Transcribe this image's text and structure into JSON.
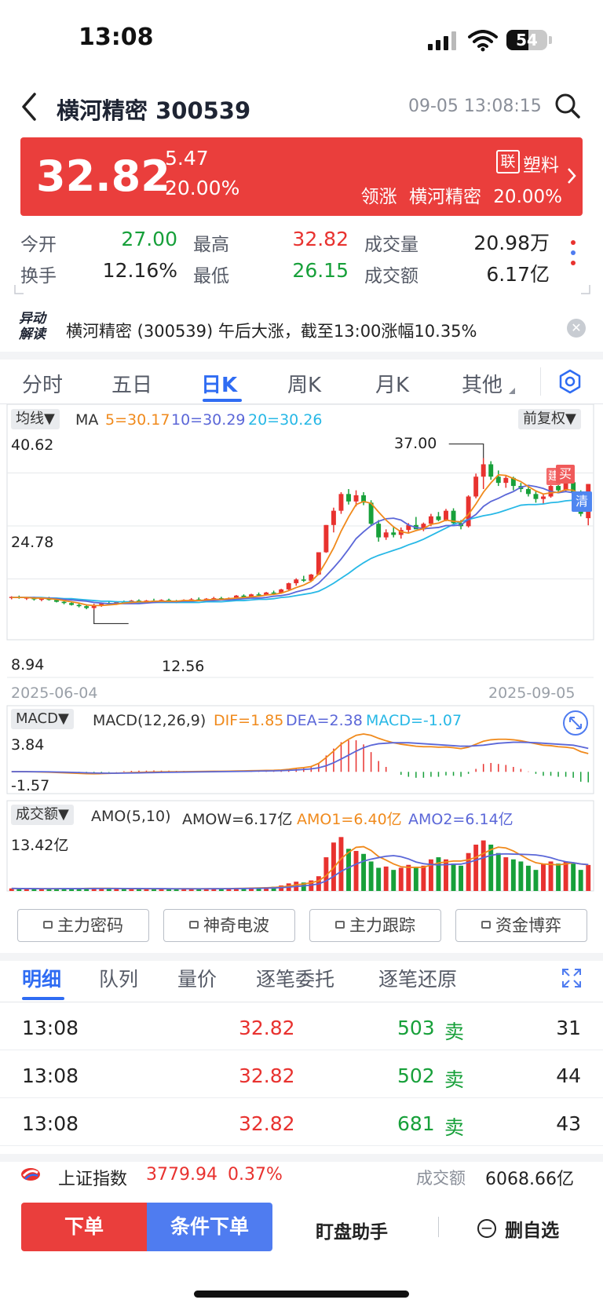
{
  "status_bar": {
    "time": "13:08",
    "battery": "54",
    "battery_level": 0.54
  },
  "nav": {
    "title": "横河精密 300539",
    "datetime": "09-05 13:08:15"
  },
  "quote": {
    "price": "32.82",
    "change": "5.47",
    "change_pct": "20.00%",
    "sector_badge": "联",
    "sector_name": "塑料",
    "lead_label": "领涨",
    "lead_stock": "横河精密",
    "lead_pct": "20.00%"
  },
  "stats": [
    {
      "label": "今开",
      "value": "27.00",
      "color": "#17a03a"
    },
    {
      "label": "最高",
      "value": "32.82",
      "color": "#e8322f"
    },
    {
      "label": "成交量",
      "value": "20.98万",
      "color": "#222222"
    },
    {
      "label": "换手",
      "value": "12.16%",
      "color": "#222222"
    },
    {
      "label": "最低",
      "value": "26.15",
      "color": "#17a03a"
    },
    {
      "label": "成交额",
      "value": "6.17亿",
      "color": "#222222"
    }
  ],
  "news": {
    "tag_line1": "异动",
    "tag_line2": "解读",
    "text": "横河精密 (300539) 午后大涨，截至13:00涨幅10.35%"
  },
  "chart_tabs": [
    "分时",
    "五日",
    "日K",
    "周K",
    "月K",
    "其他"
  ],
  "active_chart_tab": "日K",
  "kline": {
    "ma_selector": "均线▼",
    "ma_prefix": "MA",
    "ma5": "5=30.17",
    "ma10": "10=30.29",
    "ma20": "20=30.26",
    "adjust": "前复权▼",
    "y_max": "40.62",
    "y_mid": "24.78",
    "y_min": "8.94",
    "high_label": "37.00",
    "low_label": "12.56",
    "date_start": "2025-06-04",
    "date_end": "2025-09-05",
    "buy_mark": "买",
    "build_mark": "建",
    "clear_mark": "清",
    "macd_selector": "MACD▼",
    "macd_params": "MACD(12,26,9)",
    "dif": "DIF=1.85",
    "dea": "DEA=2.38",
    "macd": "MACD=-1.07",
    "macd_max": "3.84",
    "macd_min": "-1.57",
    "amo_selector": "成交额▼",
    "amo_params": "AMO(5,10)",
    "amow": "AMOW=6.17亿",
    "amo1": "AMO1=6.40亿",
    "amo2": "AMO2=6.14亿",
    "amo_max": "13.42亿"
  },
  "chart_data": {
    "type": "candlestick",
    "y_range": [
      8.94,
      40.62
    ],
    "x_range": [
      "2025-06-04",
      "2025-09-05"
    ],
    "candles": [
      [
        14.5,
        14.7,
        14.2,
        14.6
      ],
      [
        14.6,
        14.8,
        14.3,
        14.4
      ],
      [
        14.4,
        14.6,
        14.1,
        14.5
      ],
      [
        14.5,
        14.6,
        14.0,
        14.2
      ],
      [
        14.2,
        14.5,
        13.9,
        14.3
      ],
      [
        14.3,
        14.6,
        14.0,
        14.1
      ],
      [
        14.1,
        14.3,
        13.7,
        13.8
      ],
      [
        13.8,
        14.0,
        13.4,
        13.6
      ],
      [
        13.6,
        13.9,
        13.2,
        13.3
      ],
      [
        13.3,
        13.6,
        12.9,
        13.1
      ],
      [
        13.1,
        13.4,
        12.6,
        12.8
      ],
      [
        12.8,
        13.5,
        12.56,
        13.3
      ],
      [
        13.3,
        13.7,
        13.0,
        13.6
      ],
      [
        13.6,
        13.9,
        13.3,
        13.5
      ],
      [
        13.5,
        13.9,
        13.3,
        13.8
      ],
      [
        13.8,
        14.0,
        13.5,
        13.7
      ],
      [
        13.7,
        14.1,
        13.5,
        14.0
      ],
      [
        14.0,
        14.2,
        13.7,
        13.8
      ],
      [
        13.8,
        14.1,
        13.6,
        14.0
      ],
      [
        14.0,
        14.3,
        13.8,
        13.9
      ],
      [
        13.9,
        14.2,
        13.7,
        14.1
      ],
      [
        14.1,
        14.3,
        13.8,
        13.9
      ],
      [
        13.9,
        14.1,
        13.6,
        13.8
      ],
      [
        13.8,
        14.2,
        13.7,
        14.1
      ],
      [
        14.1,
        14.4,
        13.9,
        14.2
      ],
      [
        14.2,
        14.5,
        14.0,
        14.1
      ],
      [
        14.1,
        14.4,
        13.9,
        14.3
      ],
      [
        14.3,
        14.6,
        14.1,
        14.4
      ],
      [
        14.4,
        14.6,
        14.1,
        14.2
      ],
      [
        14.2,
        14.5,
        14.0,
        14.4
      ],
      [
        14.4,
        14.9,
        14.3,
        14.8
      ],
      [
        14.8,
        15.0,
        14.4,
        14.5
      ],
      [
        14.5,
        15.1,
        14.4,
        15.0
      ],
      [
        15.0,
        15.3,
        14.7,
        14.9
      ],
      [
        14.9,
        15.4,
        14.8,
        15.3
      ],
      [
        15.3,
        15.6,
        15.0,
        15.2
      ],
      [
        15.2,
        15.9,
        15.1,
        15.8
      ],
      [
        15.8,
        16.9,
        15.7,
        16.8
      ],
      [
        16.8,
        17.6,
        16.4,
        17.4
      ],
      [
        17.4,
        18.0,
        17.0,
        17.2
      ],
      [
        17.2,
        18.3,
        17.1,
        18.2
      ],
      [
        18.2,
        21.8,
        18.1,
        21.8
      ],
      [
        21.8,
        26.2,
        21.7,
        26.2
      ],
      [
        26.2,
        29.0,
        25.0,
        28.5
      ],
      [
        28.5,
        31.5,
        28.0,
        31.2
      ],
      [
        31.2,
        32.0,
        29.5,
        30.0
      ],
      [
        30.0,
        31.8,
        29.2,
        31.0
      ],
      [
        31.0,
        31.5,
        29.4,
        29.8
      ],
      [
        29.8,
        30.2,
        26.0,
        26.4
      ],
      [
        26.4,
        27.0,
        23.5,
        24.2
      ],
      [
        24.2,
        25.5,
        23.8,
        25.0
      ],
      [
        25.0,
        26.0,
        24.2,
        24.6
      ],
      [
        24.6,
        25.8,
        24.0,
        25.4
      ],
      [
        25.4,
        26.5,
        25.0,
        26.2
      ],
      [
        26.2,
        27.5,
        25.8,
        25.5
      ],
      [
        25.5,
        26.6,
        25.2,
        26.4
      ],
      [
        26.4,
        28.0,
        26.0,
        27.6
      ],
      [
        27.6,
        28.3,
        26.8,
        27.0
      ],
      [
        27.0,
        28.8,
        26.8,
        28.5
      ],
      [
        28.5,
        28.9,
        26.2,
        26.5
      ],
      [
        26.5,
        27.0,
        25.5,
        26.0
      ],
      [
        26.0,
        31.0,
        25.8,
        30.8
      ],
      [
        30.8,
        34.5,
        30.5,
        34.0
      ],
      [
        34.0,
        37.0,
        32.0,
        36.0
      ],
      [
        36.0,
        36.5,
        33.5,
        34.0
      ],
      [
        34.0,
        35.0,
        32.5,
        33.0
      ],
      [
        33.0,
        34.2,
        32.2,
        33.8
      ],
      [
        33.8,
        34.0,
        31.8,
        32.5
      ],
      [
        32.5,
        33.0,
        31.5,
        32.0
      ],
      [
        32.0,
        32.4,
        30.8,
        31.2
      ],
      [
        31.2,
        31.8,
        29.8,
        30.4
      ],
      [
        30.4,
        31.2,
        29.6,
        30.8
      ],
      [
        30.8,
        33.0,
        30.6,
        32.5
      ],
      [
        32.5,
        33.2,
        31.5,
        31.8
      ],
      [
        31.8,
        33.5,
        31.6,
        33.1
      ],
      [
        33.1,
        33.4,
        31.0,
        31.5
      ],
      [
        31.5,
        31.8,
        27.6,
        28.0
      ],
      [
        27.3,
        32.82,
        26.15,
        32.82
      ]
    ],
    "ma5": [
      14.5,
      14.5,
      14.5,
      14.4,
      14.4,
      14.3,
      14.2,
      14.0,
      13.8,
      13.6,
      13.3,
      13.2,
      13.2,
      13.3,
      13.4,
      13.6,
      13.7,
      13.8,
      13.8,
      13.9,
      13.9,
      13.9,
      13.9,
      14.0,
      14.0,
      14.0,
      14.1,
      14.2,
      14.2,
      14.3,
      14.4,
      14.5,
      14.6,
      14.7,
      14.9,
      15.0,
      15.2,
      15.6,
      16.1,
      16.5,
      17.1,
      18.3,
      20.3,
      22.5,
      25.2,
      27.5,
      29.5,
      30.0,
      29.7,
      28.3,
      27.0,
      25.9,
      25.1,
      24.9,
      25.3,
      25.6,
      26.3,
      26.5,
      27.0,
      26.8,
      26.7,
      27.9,
      29.6,
      31.5,
      33.0,
      34.3,
      34.2,
      33.7,
      33.2,
      32.4,
      31.7,
      31.2,
      31.4,
      31.5,
      31.9,
      31.8,
      31.1,
      31.2
    ],
    "ma10": [
      14.5,
      14.5,
      14.5,
      14.5,
      14.4,
      14.4,
      14.3,
      14.2,
      14.1,
      14.0,
      13.9,
      13.7,
      13.6,
      13.5,
      13.5,
      13.5,
      13.5,
      13.5,
      13.6,
      13.7,
      13.8,
      13.8,
      13.8,
      13.9,
      13.9,
      14.0,
      14.0,
      14.0,
      14.1,
      14.1,
      14.2,
      14.3,
      14.4,
      14.4,
      14.5,
      14.7,
      14.8,
      15.0,
      15.4,
      15.7,
      16.0,
      16.8,
      18.0,
      19.3,
      20.7,
      22.3,
      24.0,
      25.1,
      26.1,
      26.8,
      27.2,
      27.3,
      27.0,
      26.2,
      25.8,
      25.6,
      25.7,
      25.8,
      26.1,
      26.1,
      26.2,
      27.1,
      27.9,
      29.2,
      30.0,
      30.5,
      31.1,
      31.6,
      32.3,
      32.6,
      32.4,
      32.1,
      31.6,
      31.4,
      31.6,
      31.4,
      30.9,
      31.0
    ],
    "ma20": [
      14.5,
      14.5,
      14.5,
      14.5,
      14.5,
      14.4,
      14.4,
      14.3,
      14.3,
      14.2,
      14.1,
      14.0,
      13.9,
      13.9,
      13.8,
      13.8,
      13.8,
      13.7,
      13.7,
      13.7,
      13.7,
      13.7,
      13.7,
      13.7,
      13.7,
      13.7,
      13.8,
      13.8,
      13.8,
      13.9,
      14.0,
      14.0,
      14.1,
      14.2,
      14.2,
      14.3,
      14.5,
      14.6,
      14.8,
      15.0,
      15.2,
      15.5,
      16.1,
      16.8,
      17.6,
      18.4,
      19.3,
      20.1,
      20.8,
      21.3,
      21.7,
      22.1,
      22.5,
      23.0,
      23.4,
      23.9,
      24.5,
      25.1,
      25.7,
      26.3,
      26.7,
      27.1,
      27.4,
      27.7,
      27.9,
      28.2,
      28.6,
      29.0,
      29.4,
      29.5,
      29.5,
      29.6,
      29.8,
      29.9,
      30.1,
      30.2,
      30.1,
      30.26
    ],
    "macd": {
      "range": [
        -1.57,
        3.84
      ],
      "dif": [
        0.02,
        0.02,
        0.01,
        0.0,
        -0.02,
        -0.04,
        -0.07,
        -0.1,
        -0.13,
        -0.16,
        -0.19,
        -0.2,
        -0.18,
        -0.16,
        -0.13,
        -0.1,
        -0.07,
        -0.05,
        -0.03,
        -0.01,
        0.0,
        0.01,
        0.01,
        0.02,
        0.03,
        0.04,
        0.05,
        0.06,
        0.06,
        0.07,
        0.09,
        0.1,
        0.12,
        0.13,
        0.15,
        0.16,
        0.19,
        0.26,
        0.36,
        0.43,
        0.54,
        0.86,
        1.45,
        2.1,
        2.8,
        3.3,
        3.7,
        3.84,
        3.7,
        3.4,
        3.15,
        2.95,
        2.8,
        2.7,
        2.6,
        2.55,
        2.55,
        2.5,
        2.52,
        2.45,
        2.35,
        2.5,
        2.8,
        3.1,
        3.25,
        3.3,
        3.3,
        3.25,
        3.15,
        3.0,
        2.85,
        2.7,
        2.65,
        2.55,
        2.5,
        2.4,
        2.05,
        1.85
      ],
      "dea": [
        0.02,
        0.02,
        0.02,
        0.01,
        0.01,
        0.0,
        -0.02,
        -0.03,
        -0.05,
        -0.07,
        -0.1,
        -0.12,
        -0.13,
        -0.14,
        -0.14,
        -0.13,
        -0.12,
        -0.11,
        -0.09,
        -0.08,
        -0.06,
        -0.05,
        -0.04,
        -0.03,
        -0.02,
        -0.01,
        0.0,
        0.01,
        0.02,
        0.03,
        0.04,
        0.05,
        0.06,
        0.08,
        0.09,
        0.1,
        0.12,
        0.15,
        0.19,
        0.24,
        0.3,
        0.41,
        0.62,
        0.92,
        1.3,
        1.7,
        2.1,
        2.45,
        2.7,
        2.85,
        2.9,
        2.95,
        2.95,
        2.95,
        2.9,
        2.85,
        2.8,
        2.75,
        2.7,
        2.65,
        2.6,
        2.6,
        2.65,
        2.7,
        2.8,
        2.9,
        2.95,
        3.0,
        3.0,
        2.98,
        2.95,
        2.9,
        2.85,
        2.8,
        2.75,
        2.7,
        2.55,
        2.38
      ]
    },
    "amo": {
      "max": 13.42,
      "values": [
        0.6,
        0.55,
        0.5,
        0.55,
        0.5,
        0.5,
        0.55,
        0.6,
        0.55,
        0.6,
        0.65,
        0.7,
        0.6,
        0.55,
        0.5,
        0.5,
        0.55,
        0.5,
        0.5,
        0.5,
        0.55,
        0.5,
        0.5,
        0.55,
        0.5,
        0.5,
        0.55,
        0.6,
        0.55,
        0.6,
        0.7,
        0.7,
        0.8,
        0.75,
        0.9,
        1.0,
        1.3,
        1.8,
        2.2,
        2.0,
        2.5,
        3.5,
        8.0,
        11.5,
        12.8,
        10.0,
        9.5,
        8.8,
        7.0,
        5.5,
        5.8,
        5.0,
        5.5,
        6.2,
        5.5,
        6.0,
        7.5,
        8.0,
        7.5,
        6.5,
        6.0,
        9.0,
        11.0,
        12.0,
        11.0,
        9.0,
        8.0,
        7.5,
        7.0,
        6.0,
        5.0,
        6.5,
        7.0,
        6.5,
        7.0,
        6.5,
        5.0,
        6.17
      ]
    }
  },
  "tool_buttons": [
    "主力密码",
    "神奇电波",
    "主力跟踪",
    "资金博弈"
  ],
  "detail_tabs": [
    "明细",
    "队列",
    "量价",
    "逐笔委托",
    "逐笔还原"
  ],
  "active_detail_tab": "明细",
  "trades": [
    {
      "time": "13:08",
      "price": "32.82",
      "volume": "503",
      "side": "卖",
      "count": "31"
    },
    {
      "time": "13:08",
      "price": "32.82",
      "volume": "502",
      "side": "卖",
      "count": "44"
    },
    {
      "time": "13:08",
      "price": "32.82",
      "volume": "681",
      "side": "卖",
      "count": "43"
    }
  ],
  "index_bar": {
    "name": "上证指数",
    "value": "3779.94",
    "pct": "0.37%",
    "turnover_label": "成交额",
    "turnover": "6068.66亿"
  },
  "actions": {
    "order": "下单",
    "conditional": "条件下单",
    "assistant": "盯盘助手",
    "remove": "删自选"
  },
  "colors": {
    "up": "#e8322f",
    "down": "#17a03a",
    "accent": "#2f6cf3",
    "ma5": "#f08a1c",
    "ma10": "#5b67d8",
    "ma20": "#27b8e6"
  }
}
